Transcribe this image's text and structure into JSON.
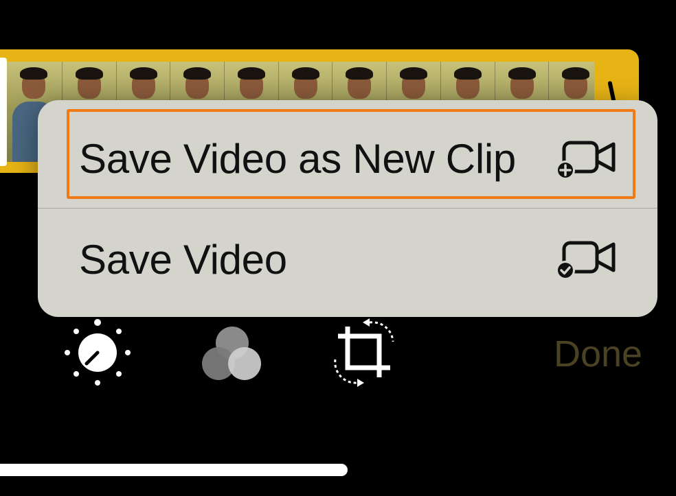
{
  "menu": {
    "items": [
      {
        "label": "Save Video as New Clip",
        "icon": "video-add-icon"
      },
      {
        "label": "Save Video",
        "icon": "video-check-icon"
      }
    ]
  },
  "toolbar": {
    "tools": [
      {
        "icon": "adjust-dial-icon"
      },
      {
        "icon": "filters-icon"
      },
      {
        "icon": "crop-rotate-icon"
      }
    ],
    "done_label": "Done"
  },
  "colors": {
    "trimmer": "#e7b416",
    "menu_background": "#d4d4cd",
    "highlight": "#f07a16",
    "done_text": "#4a4222"
  }
}
